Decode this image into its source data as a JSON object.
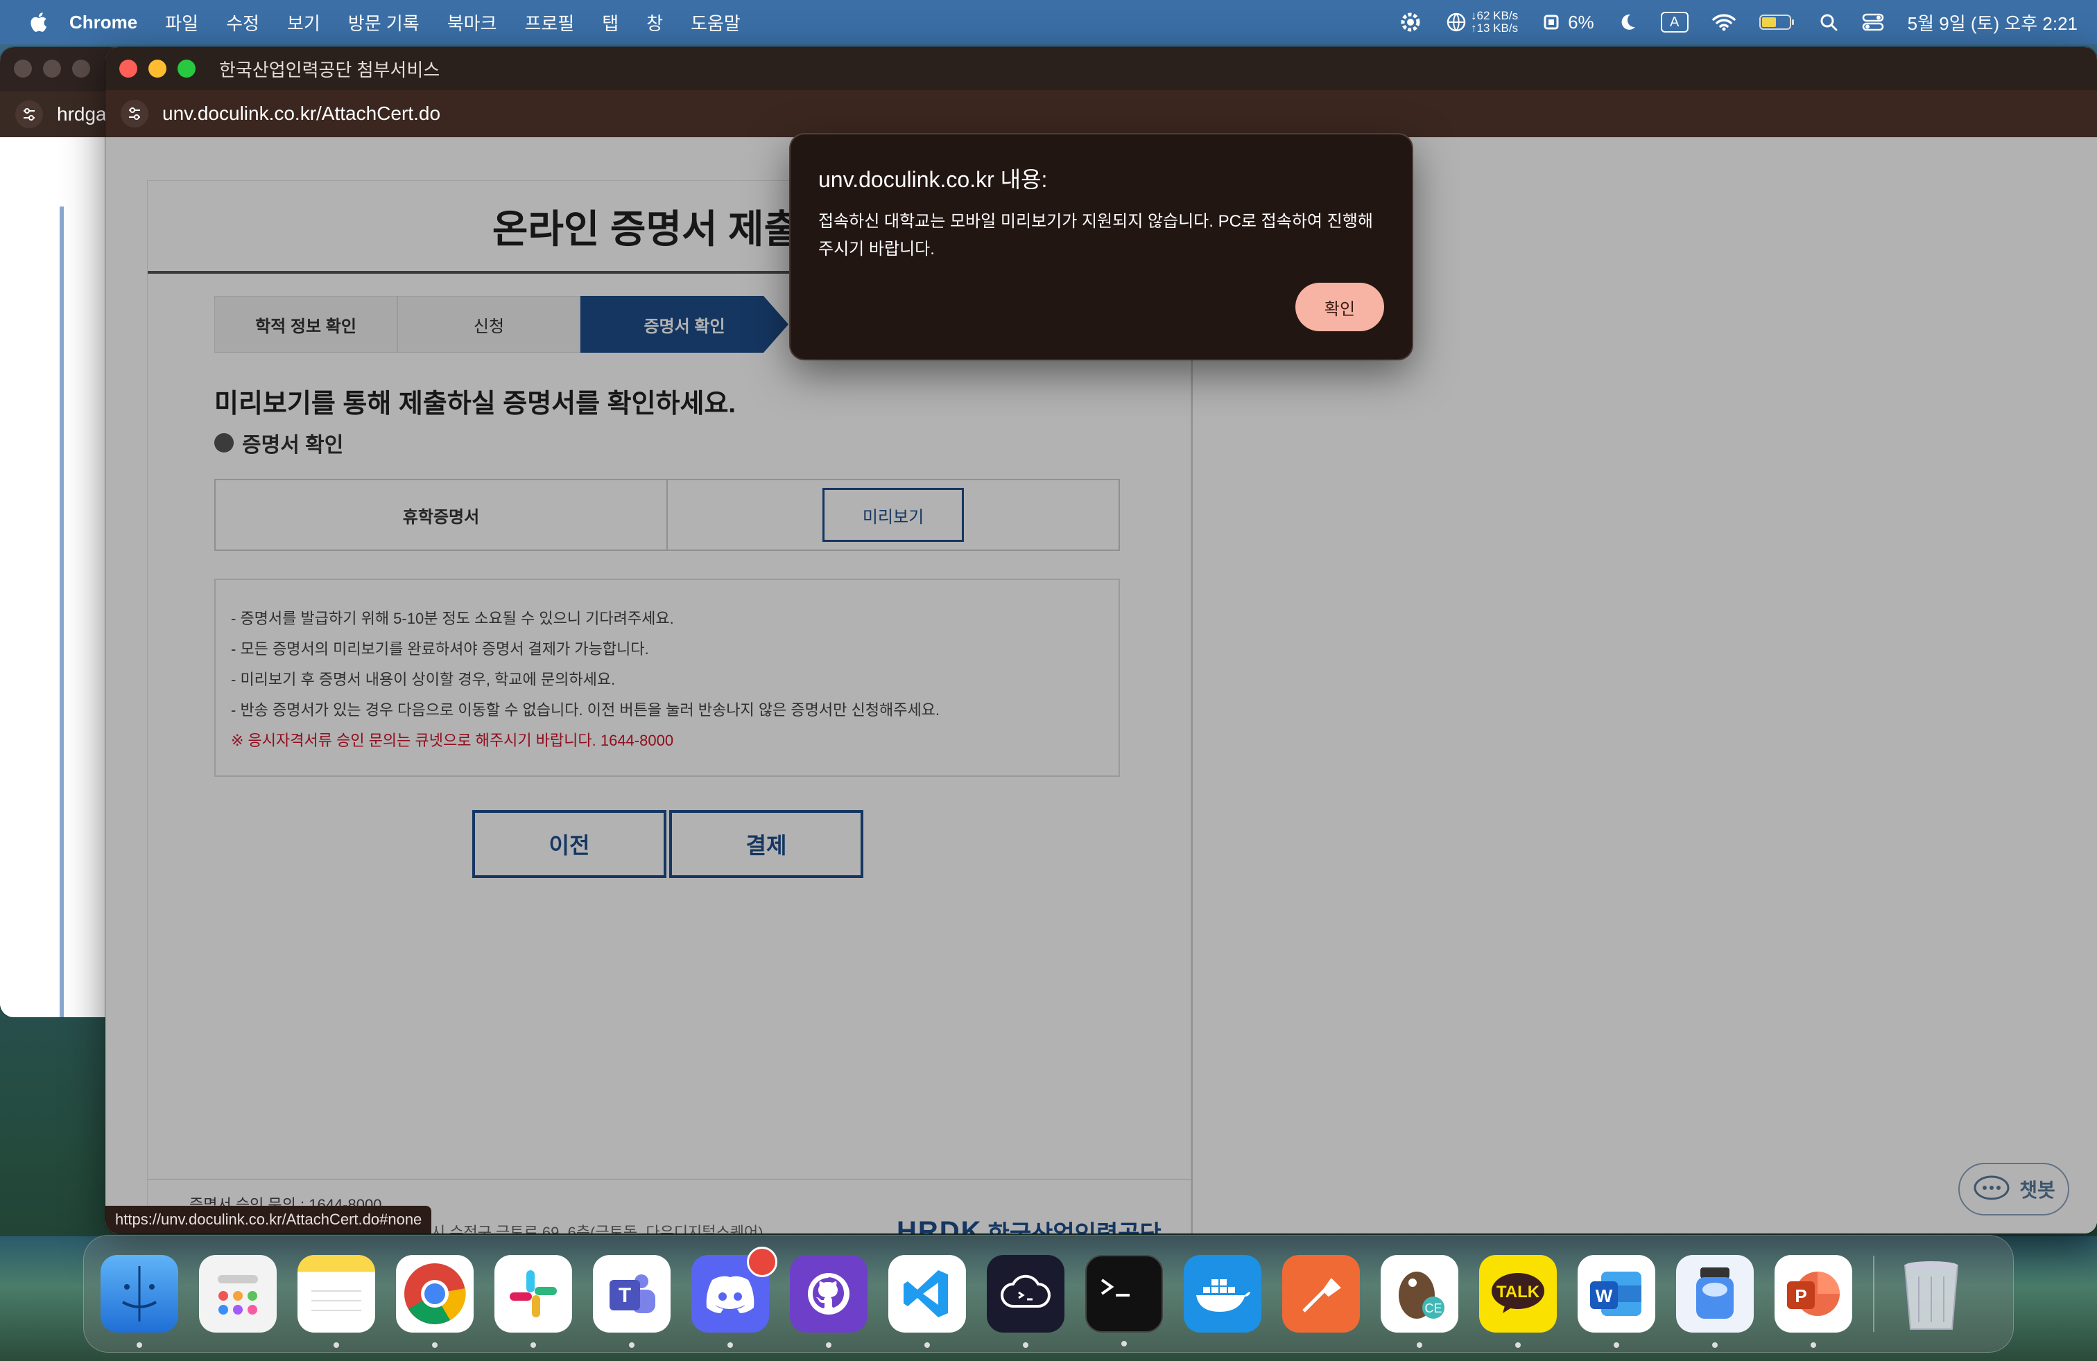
{
  "menubar": {
    "app": "Chrome",
    "items": [
      "파일",
      "수정",
      "보기",
      "방문 기록",
      "북마크",
      "프로필",
      "탭",
      "창",
      "도움말"
    ],
    "net_down": "↓62 KB/s",
    "net_up": "↑13 KB/s",
    "cpu": "6%",
    "input_mode": "A",
    "datetime": "5월 9일 (토) 오후 2:21"
  },
  "back_window": {
    "address": "hrdga"
  },
  "window": {
    "title": "한국산업인력공단 첨부서비스",
    "url": "unv.doculink.co.kr/AttachCert.do"
  },
  "page": {
    "title": "온라인 증명서 제출 서",
    "steps": [
      "학적 정보 확인",
      "신청",
      "증명서 확인"
    ],
    "headline": "미리보기를 통해 제출하실 증명서를 확인하세요.",
    "subhead": "증명서 확인",
    "certificate": {
      "name": "휴학증명서",
      "preview_label": "미리보기"
    },
    "notices": [
      "- 증명서를 발급하기 위해 5-10분 정도 소요될 수 있으니 기다려주세요.",
      "- 모든 증명서의 미리보기를 완료하셔야 증명서 결제가 가능합니다.",
      "- 미리보기 후 증명서 내용이 상이할 경우, 학교에 문의하세요.",
      "- 반송 증명서가 있는 경우 다음으로 이동할 수 없습니다. 이전 버튼을 눌러 반송나지 않은 증명서만 신청해주세요."
    ],
    "notice_red": "※ 응시자격서류 승인 문의는 큐넷으로 해주시기 바랍니다. 1644-8000",
    "prev_label": "이전",
    "pay_label": "결제",
    "footer_contact": "증명서 승인 문의 : 1644-8000",
    "footer_address": "한국정보인증(주) | 13453 경기도 성남시 수정구 금토로 69, 6층(금토동, 다우디지털스퀘어)",
    "logo_mark": "HRDK",
    "logo_name": "한국산업인력공단",
    "chatbot_label": "챗봇"
  },
  "status_url": "https://unv.doculink.co.kr/AttachCert.do#none",
  "dialog": {
    "title": "unv.doculink.co.kr 내용:",
    "message": "접속하신 대학교는 모바일 미리보기가 지원되지 않습니다. PC로 접속하여 진행해주시기 바랍니다.",
    "ok_label": "확인"
  },
  "dock": {
    "apps": [
      "finder-icon",
      "launchpad-icon",
      "notes-icon",
      "chrome-icon",
      "slack-icon",
      "teams-icon",
      "discord-icon",
      "github-desktop-icon",
      "vscode-icon",
      "chatgpt-icon",
      "terminal-icon",
      "docker-icon",
      "postman-icon",
      "dbeaver-icon",
      "kakaotalk-icon",
      "word-icon",
      "preview-icon",
      "powerpoint-icon",
      "trash-icon"
    ]
  },
  "colors": {
    "menubar": "#3b6fa6",
    "brand_blue": "#1f4e8c",
    "dialog_bg": "#221613",
    "ok_button": "#f7b3a3",
    "notice_red": "#d0142a"
  }
}
